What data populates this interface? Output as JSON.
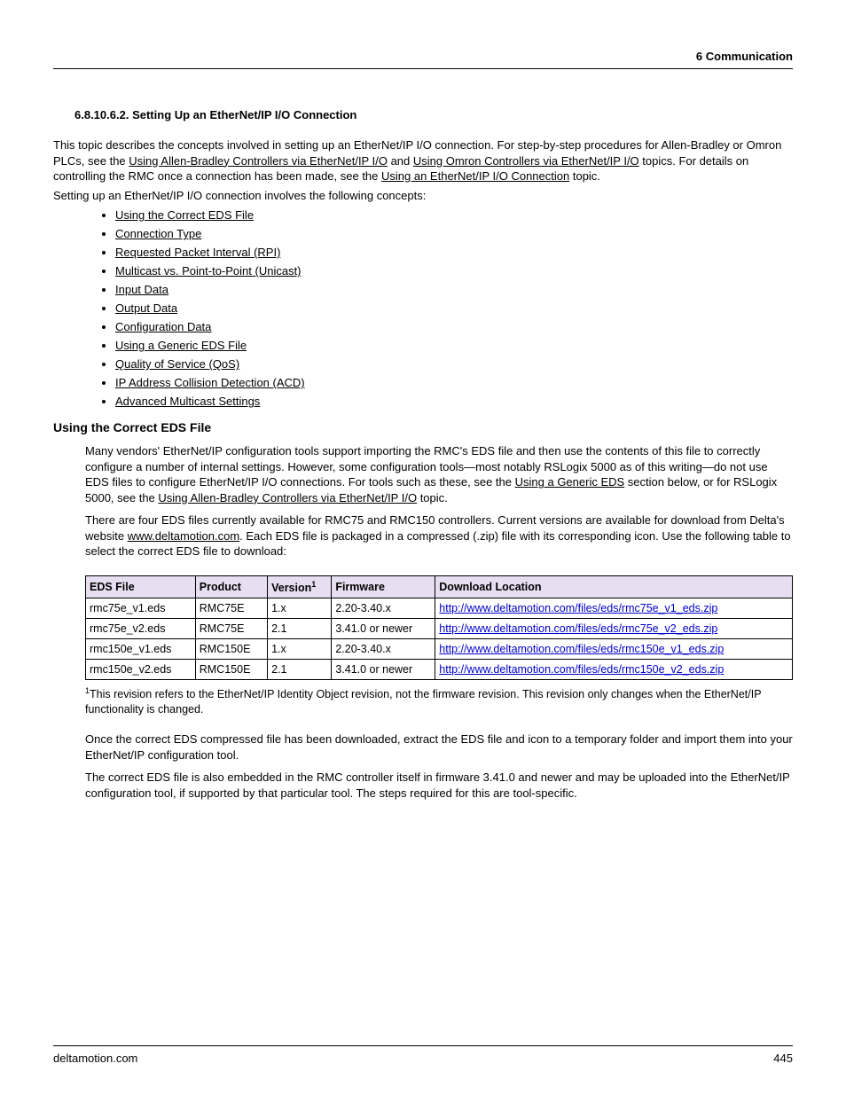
{
  "header": {
    "text": "6  Communication"
  },
  "section": {
    "number": "6.8.10.6.2.",
    "title": "Setting Up an EtherNet/IP I/O Connection"
  },
  "intro": {
    "p1a": "This topic describes the concepts involved in setting up an EtherNet/IP I/O connection. For step-by-step procedures for Allen-Bradley or Omron PLCs, see the ",
    "link1": "Using Allen-Bradley Controllers via EtherNet/IP I/O",
    "p1b": " and ",
    "link2": "Using Omron Controllers via EtherNet/IP I/O",
    "p1c": " topics. For details on controlling the RMC once a connection has been made, see the ",
    "link3": "Using an EtherNet/IP I/O Connection",
    "p1d": " topic.",
    "p2": "Setting up an EtherNet/IP I/O connection involves the following concepts:"
  },
  "concepts": [
    "Using the Correct EDS File",
    "Connection Type",
    "Requested Packet Interval (RPI)",
    "Multicast vs. Point-to-Point (Unicast)",
    "Input Data",
    "Output Data",
    "Configuration Data",
    "Using a Generic EDS File",
    "Quality of Service (QoS)",
    "IP Address Collision Detection (ACD)",
    "Advanced Multicast Settings"
  ],
  "eds_section": {
    "heading": "Using the Correct EDS File",
    "p1a": "Many vendors' EtherNet/IP configuration tools support importing the RMC's EDS file and then use the contents of this file to correctly configure a number of internal settings. However, some configuration tools—most notably RSLogix 5000 as of this writing—do not use EDS files to configure EtherNet/IP I/O connections. For tools such as these, see the ",
    "link1": "Using a Generic EDS",
    "p1b": " section below, or for RSLogix 5000, see the ",
    "link2": "Using Allen-Bradley Controllers via EtherNet/IP I/O",
    "p1c": " topic.",
    "p2a": "There are four EDS files currently available for RMC75 and RMC150 controllers. Current versions are available for download from Delta's website ",
    "link3": "www.deltamotion.com",
    "p2b": ". Each EDS file is packaged in a compressed (.zip) file with its corresponding icon. Use the following table to select the correct EDS file to download:"
  },
  "table": {
    "headers": [
      "EDS File",
      "Product",
      "Version",
      "Firmware",
      "Download Location"
    ],
    "version_sup": "1",
    "rows": [
      {
        "file": "rmc75e_v1.eds",
        "product": "RMC75E",
        "version": "1.x",
        "firmware": "2.20-3.40.x",
        "url": "http://www.deltamotion.com/files/eds/rmc75e_v1_eds.zip"
      },
      {
        "file": "rmc75e_v2.eds",
        "product": "RMC75E",
        "version": "2.1",
        "firmware": "3.41.0 or newer",
        "url": "http://www.deltamotion.com/files/eds/rmc75e_v2_eds.zip"
      },
      {
        "file": "rmc150e_v1.eds",
        "product": "RMC150E",
        "version": "1.x",
        "firmware": "2.20-3.40.x",
        "url": "http://www.deltamotion.com/files/eds/rmc150e_v1_eds.zip"
      },
      {
        "file": "rmc150e_v2.eds",
        "product": "RMC150E",
        "version": "2.1",
        "firmware": "3.41.0 or newer",
        "url": "http://www.deltamotion.com/files/eds/rmc150e_v2_eds.zip"
      }
    ]
  },
  "footnote": {
    "sup": "1",
    "text": "This revision refers to the EtherNet/IP Identity Object revision, not the firmware revision. This revision only changes when the EtherNet/IP functionality is changed."
  },
  "after_table": {
    "p1": "Once the correct EDS compressed file has been downloaded, extract the EDS file and icon to a temporary folder and import them into your EtherNet/IP configuration tool.",
    "p2": "The correct EDS file is also embedded in the RMC controller itself in firmware 3.41.0 and newer and may be uploaded into the EtherNet/IP configuration tool, if supported by that particular tool. The steps required for this are tool-specific."
  },
  "footer": {
    "left": "deltamotion.com",
    "right": "445"
  }
}
